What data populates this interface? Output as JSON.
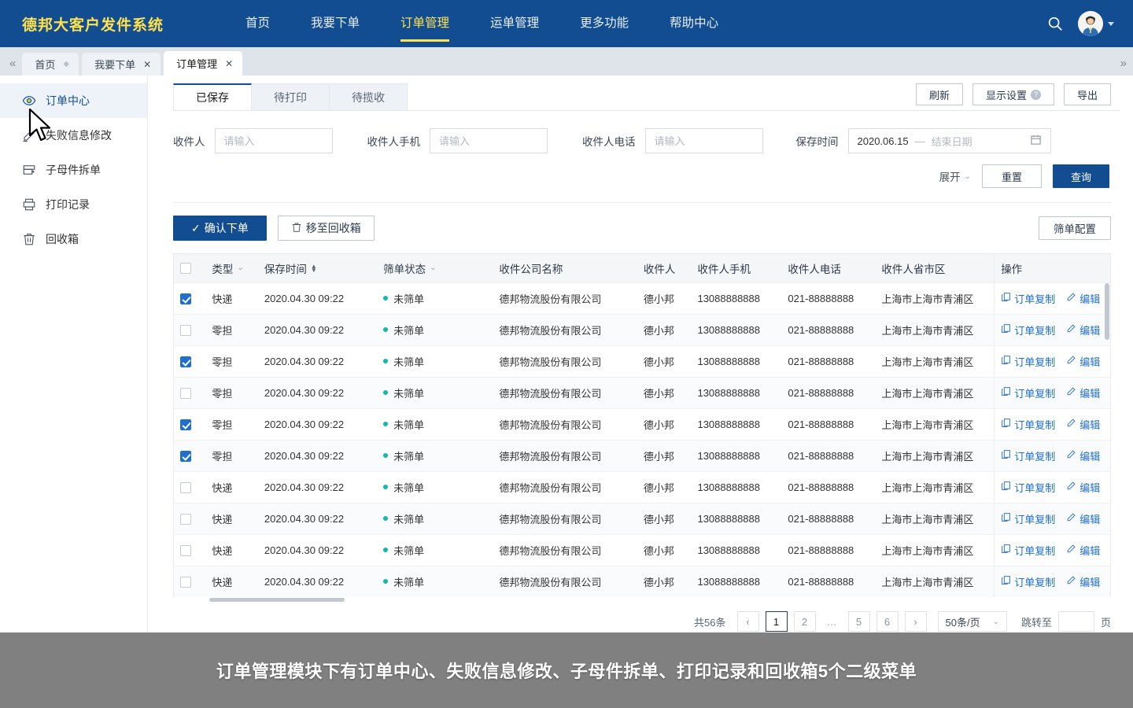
{
  "topnav": {
    "brand": "德邦大客户发件系统",
    "items": [
      {
        "label": "首页",
        "active": false
      },
      {
        "label": "我要下单",
        "active": false
      },
      {
        "label": "订单管理",
        "active": true
      },
      {
        "label": "运单管理",
        "active": false
      },
      {
        "label": "更多功能",
        "active": false
      },
      {
        "label": "帮助中心",
        "active": false
      }
    ],
    "search_icon": "search-icon",
    "avatar_icon": "user-avatar",
    "accent_color": "#ffe14d",
    "bg_color": "#134d91"
  },
  "tabstrip": {
    "collapse_left": "«",
    "collapse_right": "»",
    "tabs": [
      {
        "label": "首页",
        "closable": false,
        "pinned": true,
        "active": false
      },
      {
        "label": "我要下单",
        "closable": true,
        "pinned": false,
        "active": false
      },
      {
        "label": "订单管理",
        "closable": true,
        "pinned": false,
        "active": true
      }
    ],
    "close_glyph": "✕"
  },
  "sidebar": {
    "items": [
      {
        "label": "订单中心",
        "icon": "eye-icon",
        "active": true
      },
      {
        "label": "失败信息修改",
        "icon": "edit-icon",
        "active": false
      },
      {
        "label": "子母件拆单",
        "icon": "split-box-icon",
        "active": false
      },
      {
        "label": "打印记录",
        "icon": "printer-icon",
        "active": false
      },
      {
        "label": "回收箱",
        "icon": "trash-icon",
        "active": false
      }
    ]
  },
  "subtabs": [
    {
      "label": "已保存",
      "active": true
    },
    {
      "label": "待打印",
      "active": false
    },
    {
      "label": "待揽收",
      "active": false
    }
  ],
  "header_buttons": {
    "refresh": "刷新",
    "display_settings": "显示设置",
    "display_settings_help": "?",
    "export": "导出"
  },
  "filters": {
    "recipient": {
      "label": "收件人",
      "value": "",
      "placeholder": "请输入"
    },
    "recipient_mobile": {
      "label": "收件人手机",
      "value": "",
      "placeholder": "请输入"
    },
    "recipient_phone": {
      "label": "收件人电话",
      "value": "",
      "placeholder": "请输入"
    },
    "save_time": {
      "label": "保存时间",
      "start": "2020.06.15",
      "separator": "—",
      "end_placeholder": "结束日期",
      "calendar_icon": "calendar-icon"
    },
    "expand_label": "展开",
    "reset_label": "重置",
    "search_label": "查询"
  },
  "actions": {
    "confirm_order": "确认下单",
    "move_to_recycle": "移至回收箱",
    "screen_config": "筛单配置"
  },
  "table": {
    "columns": [
      {
        "key": "checkbox",
        "label": "",
        "cls": "c-cb"
      },
      {
        "key": "type",
        "label": "类型",
        "cls": "c-type",
        "filter": true
      },
      {
        "key": "save_time",
        "label": "保存时间",
        "cls": "c-time",
        "sortable": true
      },
      {
        "key": "screen_status",
        "label": "筛单状态",
        "cls": "c-stat",
        "filter": true
      },
      {
        "key": "company",
        "label": "收件公司名称",
        "cls": "c-comp"
      },
      {
        "key": "recipient",
        "label": "收件人",
        "cls": "c-name"
      },
      {
        "key": "mobile",
        "label": "收件人手机",
        "cls": "c-mob"
      },
      {
        "key": "phone",
        "label": "收件人电话",
        "cls": "c-tel"
      },
      {
        "key": "area",
        "label": "收件人省市区",
        "cls": "c-area"
      },
      {
        "key": "operation",
        "label": "操作",
        "cls": "c-op"
      }
    ],
    "op_links": [
      {
        "label": "订单复制",
        "icon": "copy-icon"
      },
      {
        "label": "编辑",
        "icon": "pencil-icon"
      }
    ],
    "status_color": "#19b4b4",
    "rows": [
      {
        "checked": true,
        "type": "快递",
        "save_time": "2020.04.30 09:22",
        "screen_status": "未筛单",
        "company": "德邦物流股份有限公司",
        "recipient": "德小邦",
        "mobile": "13088888888",
        "phone": "021-88888888",
        "area": "上海市上海市青浦区"
      },
      {
        "checked": false,
        "type": "零担",
        "save_time": "2020.04.30 09:22",
        "screen_status": "未筛单",
        "company": "德邦物流股份有限公司",
        "recipient": "德小邦",
        "mobile": "13088888888",
        "phone": "021-88888888",
        "area": "上海市上海市青浦区"
      },
      {
        "checked": true,
        "type": "零担",
        "save_time": "2020.04.30 09:22",
        "screen_status": "未筛单",
        "company": "德邦物流股份有限公司",
        "recipient": "德小邦",
        "mobile": "13088888888",
        "phone": "021-88888888",
        "area": "上海市上海市青浦区"
      },
      {
        "checked": false,
        "type": "零担",
        "save_time": "2020.04.30 09:22",
        "screen_status": "未筛单",
        "company": "德邦物流股份有限公司",
        "recipient": "德小邦",
        "mobile": "13088888888",
        "phone": "021-88888888",
        "area": "上海市上海市青浦区"
      },
      {
        "checked": true,
        "type": "零担",
        "save_time": "2020.04.30 09:22",
        "screen_status": "未筛单",
        "company": "德邦物流股份有限公司",
        "recipient": "德小邦",
        "mobile": "13088888888",
        "phone": "021-88888888",
        "area": "上海市上海市青浦区"
      },
      {
        "checked": true,
        "type": "零担",
        "save_time": "2020.04.30 09:22",
        "screen_status": "未筛单",
        "company": "德邦物流股份有限公司",
        "recipient": "德小邦",
        "mobile": "13088888888",
        "phone": "021-88888888",
        "area": "上海市上海市青浦区"
      },
      {
        "checked": false,
        "type": "快递",
        "save_time": "2020.04.30 09:22",
        "screen_status": "未筛单",
        "company": "德邦物流股份有限公司",
        "recipient": "德小邦",
        "mobile": "13088888888",
        "phone": "021-88888888",
        "area": "上海市上海市青浦区"
      },
      {
        "checked": false,
        "type": "快递",
        "save_time": "2020.04.30 09:22",
        "screen_status": "未筛单",
        "company": "德邦物流股份有限公司",
        "recipient": "德小邦",
        "mobile": "13088888888",
        "phone": "021-88888888",
        "area": "上海市上海市青浦区"
      },
      {
        "checked": false,
        "type": "快递",
        "save_time": "2020.04.30 09:22",
        "screen_status": "未筛单",
        "company": "德邦物流股份有限公司",
        "recipient": "德小邦",
        "mobile": "13088888888",
        "phone": "021-88888888",
        "area": "上海市上海市青浦区"
      },
      {
        "checked": false,
        "type": "快递",
        "save_time": "2020.04.30 09:22",
        "screen_status": "未筛单",
        "company": "德邦物流股份有限公司",
        "recipient": "德小邦",
        "mobile": "13088888888",
        "phone": "021-88888888",
        "area": "上海市上海市青浦区"
      }
    ]
  },
  "pagination": {
    "total_text": "共56条",
    "prev": "‹",
    "next": "›",
    "pages": [
      "1",
      "2",
      "…",
      "5",
      "6"
    ],
    "current_page": "1",
    "page_size": "50条/页",
    "jump_label": "跳转至",
    "jump_value": "",
    "page_unit": "页"
  },
  "caption": {
    "text": "订单管理模块下有订单中心、失败信息修改、子母件拆单、打印记录和回收箱5个二级菜单"
  }
}
